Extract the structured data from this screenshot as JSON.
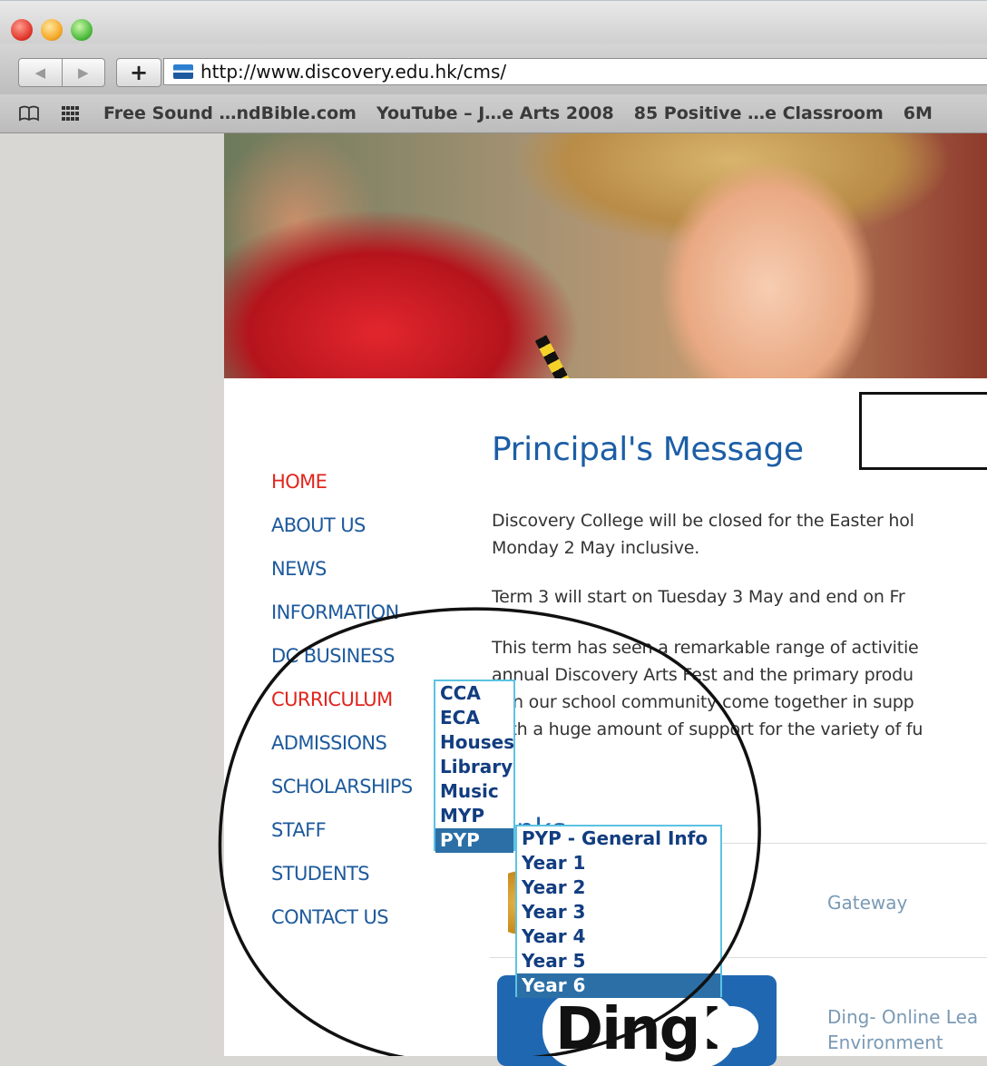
{
  "browser": {
    "nav_back": "◀",
    "nav_forward": "▶",
    "new_tab": "+",
    "url": "http://www.discovery.edu.hk/cms/",
    "bookmarks": [
      "Free Sound …ndBible.com",
      "YouTube – J…e Arts 2008",
      "85 Positive …e Classroom",
      "6M"
    ]
  },
  "nav": {
    "items": [
      {
        "label": "HOME",
        "color": "#e0251d"
      },
      {
        "label": "ABOUT US"
      },
      {
        "label": "NEWS"
      },
      {
        "label": "INFORMATION"
      },
      {
        "label": "DC BUSINESS"
      },
      {
        "label": "CURRICULUM",
        "color": "#e0251d"
      },
      {
        "label": "ADMISSIONS"
      },
      {
        "label": "SCHOLARSHIPS"
      },
      {
        "label": "STAFF"
      },
      {
        "label": "STUDENTS"
      },
      {
        "label": "CONTACT US"
      }
    ]
  },
  "main": {
    "title": "Principal's Message",
    "paragraphs": [
      [
        "Discovery College will be closed for the Easter hol",
        "Monday 2 May inclusive."
      ],
      [
        "Term 3 will start on Tuesday 3 May and end on Fr"
      ],
      [
        "This term has seen a remarkable range of activitie",
        "annual Discovery Arts Fest and the primary produ",
        "een our school community come together in supp",
        "with a huge amount of support for the variety of fu"
      ]
    ],
    "links_heading": "nks",
    "links": [
      {
        "label": "Gateway"
      },
      {
        "label": "Ding- Online Lea",
        "label2": "Environment",
        "logo_text": "Ding!"
      }
    ]
  },
  "curriculum_menu": {
    "items": [
      "CCA",
      "ECA",
      "Houses",
      "Library",
      "Music",
      "MYP",
      "PYP"
    ],
    "selected": "PYP"
  },
  "pyp_menu": {
    "items": [
      "PYP - General Info",
      "Year 1",
      "Year 2",
      "Year 3",
      "Year 4",
      "Year 5",
      "Year 6"
    ],
    "selected": "Year 6"
  },
  "colors": {
    "link_blue": "#1d5a9c",
    "active_red": "#e0251d",
    "menu_border": "#5cc3e3",
    "menu_selected": "#2b6fa6"
  }
}
